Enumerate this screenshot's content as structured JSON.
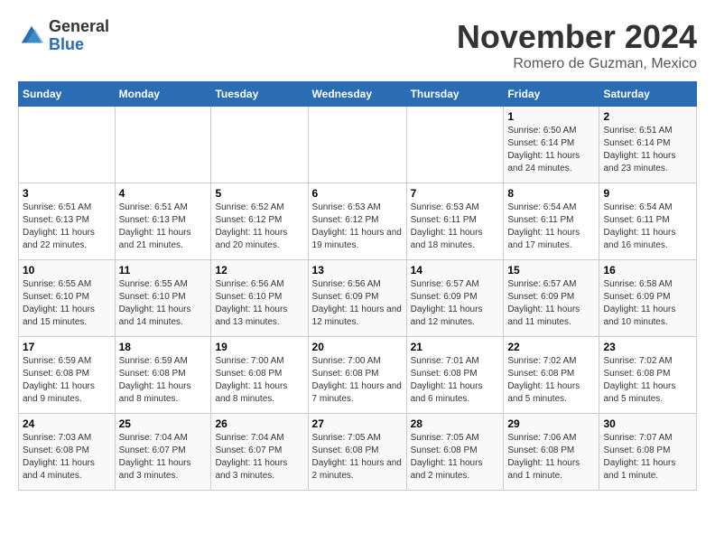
{
  "header": {
    "logo_general": "General",
    "logo_blue": "Blue",
    "month_title": "November 2024",
    "location": "Romero de Guzman, Mexico"
  },
  "weekdays": [
    "Sunday",
    "Monday",
    "Tuesday",
    "Wednesday",
    "Thursday",
    "Friday",
    "Saturday"
  ],
  "weeks": [
    [
      {
        "day": "",
        "info": ""
      },
      {
        "day": "",
        "info": ""
      },
      {
        "day": "",
        "info": ""
      },
      {
        "day": "",
        "info": ""
      },
      {
        "day": "",
        "info": ""
      },
      {
        "day": "1",
        "info": "Sunrise: 6:50 AM\nSunset: 6:14 PM\nDaylight: 11 hours and 24 minutes."
      },
      {
        "day": "2",
        "info": "Sunrise: 6:51 AM\nSunset: 6:14 PM\nDaylight: 11 hours and 23 minutes."
      }
    ],
    [
      {
        "day": "3",
        "info": "Sunrise: 6:51 AM\nSunset: 6:13 PM\nDaylight: 11 hours and 22 minutes."
      },
      {
        "day": "4",
        "info": "Sunrise: 6:51 AM\nSunset: 6:13 PM\nDaylight: 11 hours and 21 minutes."
      },
      {
        "day": "5",
        "info": "Sunrise: 6:52 AM\nSunset: 6:12 PM\nDaylight: 11 hours and 20 minutes."
      },
      {
        "day": "6",
        "info": "Sunrise: 6:53 AM\nSunset: 6:12 PM\nDaylight: 11 hours and 19 minutes."
      },
      {
        "day": "7",
        "info": "Sunrise: 6:53 AM\nSunset: 6:11 PM\nDaylight: 11 hours and 18 minutes."
      },
      {
        "day": "8",
        "info": "Sunrise: 6:54 AM\nSunset: 6:11 PM\nDaylight: 11 hours and 17 minutes."
      },
      {
        "day": "9",
        "info": "Sunrise: 6:54 AM\nSunset: 6:11 PM\nDaylight: 11 hours and 16 minutes."
      }
    ],
    [
      {
        "day": "10",
        "info": "Sunrise: 6:55 AM\nSunset: 6:10 PM\nDaylight: 11 hours and 15 minutes."
      },
      {
        "day": "11",
        "info": "Sunrise: 6:55 AM\nSunset: 6:10 PM\nDaylight: 11 hours and 14 minutes."
      },
      {
        "day": "12",
        "info": "Sunrise: 6:56 AM\nSunset: 6:10 PM\nDaylight: 11 hours and 13 minutes."
      },
      {
        "day": "13",
        "info": "Sunrise: 6:56 AM\nSunset: 6:09 PM\nDaylight: 11 hours and 12 minutes."
      },
      {
        "day": "14",
        "info": "Sunrise: 6:57 AM\nSunset: 6:09 PM\nDaylight: 11 hours and 12 minutes."
      },
      {
        "day": "15",
        "info": "Sunrise: 6:57 AM\nSunset: 6:09 PM\nDaylight: 11 hours and 11 minutes."
      },
      {
        "day": "16",
        "info": "Sunrise: 6:58 AM\nSunset: 6:09 PM\nDaylight: 11 hours and 10 minutes."
      }
    ],
    [
      {
        "day": "17",
        "info": "Sunrise: 6:59 AM\nSunset: 6:08 PM\nDaylight: 11 hours and 9 minutes."
      },
      {
        "day": "18",
        "info": "Sunrise: 6:59 AM\nSunset: 6:08 PM\nDaylight: 11 hours and 8 minutes."
      },
      {
        "day": "19",
        "info": "Sunrise: 7:00 AM\nSunset: 6:08 PM\nDaylight: 11 hours and 8 minutes."
      },
      {
        "day": "20",
        "info": "Sunrise: 7:00 AM\nSunset: 6:08 PM\nDaylight: 11 hours and 7 minutes."
      },
      {
        "day": "21",
        "info": "Sunrise: 7:01 AM\nSunset: 6:08 PM\nDaylight: 11 hours and 6 minutes."
      },
      {
        "day": "22",
        "info": "Sunrise: 7:02 AM\nSunset: 6:08 PM\nDaylight: 11 hours and 5 minutes."
      },
      {
        "day": "23",
        "info": "Sunrise: 7:02 AM\nSunset: 6:08 PM\nDaylight: 11 hours and 5 minutes."
      }
    ],
    [
      {
        "day": "24",
        "info": "Sunrise: 7:03 AM\nSunset: 6:08 PM\nDaylight: 11 hours and 4 minutes."
      },
      {
        "day": "25",
        "info": "Sunrise: 7:04 AM\nSunset: 6:07 PM\nDaylight: 11 hours and 3 minutes."
      },
      {
        "day": "26",
        "info": "Sunrise: 7:04 AM\nSunset: 6:07 PM\nDaylight: 11 hours and 3 minutes."
      },
      {
        "day": "27",
        "info": "Sunrise: 7:05 AM\nSunset: 6:08 PM\nDaylight: 11 hours and 2 minutes."
      },
      {
        "day": "28",
        "info": "Sunrise: 7:05 AM\nSunset: 6:08 PM\nDaylight: 11 hours and 2 minutes."
      },
      {
        "day": "29",
        "info": "Sunrise: 7:06 AM\nSunset: 6:08 PM\nDaylight: 11 hours and 1 minute."
      },
      {
        "day": "30",
        "info": "Sunrise: 7:07 AM\nSunset: 6:08 PM\nDaylight: 11 hours and 1 minute."
      }
    ]
  ]
}
